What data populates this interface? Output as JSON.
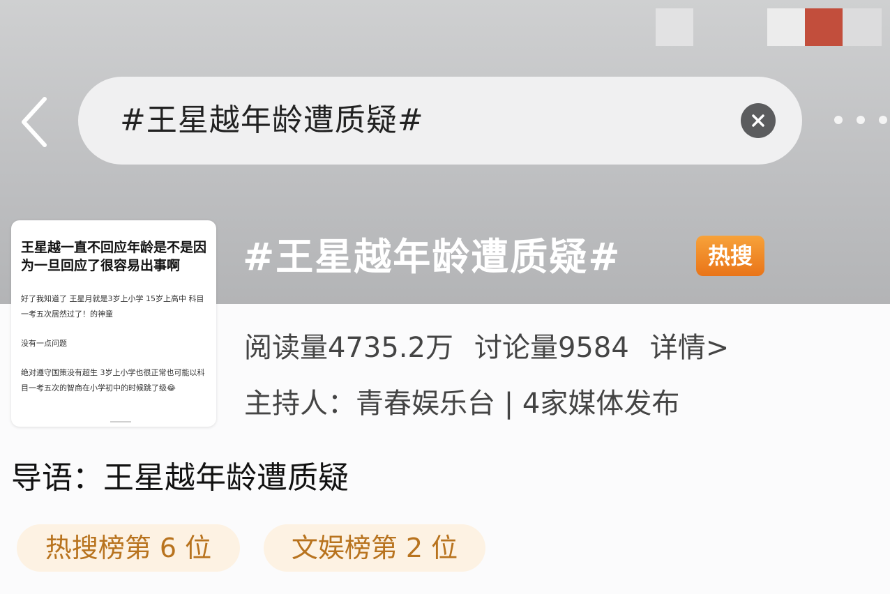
{
  "search": {
    "query": "#王星越年龄遭质疑#"
  },
  "topic": {
    "title": "#王星越年龄遭质疑#",
    "hot_badge": "热搜",
    "reads": "阅读量4735.2万",
    "discussions": "讨论量9584",
    "details_link": "详情>",
    "host_line": "主持人：青春娱乐台 | 4家媒体发布",
    "lead": "导语：王星越年龄遭质疑"
  },
  "thumbnail": {
    "title": "王星越一直不回应年龄是不是因为一旦回应了很容易出事啊",
    "body_1": "好了我知道了 王星月就是3岁上小学 15岁上高中 科目一考五次居然过了！的神童",
    "body_2": "没有一点问题",
    "body_3": "绝对遵守国策没有超生 3岁上小学也很正常也可能以科目一考五次的智商在小学初中的时候跳了级😂"
  },
  "tags": [
    {
      "label": "热搜榜第 6 位"
    },
    {
      "label": "文娱榜第 2 位"
    }
  ],
  "colors": {
    "hot_badge": "#ee8a22",
    "tag_bg": "#fdf2e3",
    "tag_text": "#b8731e",
    "header_bg": "#c3c4c6"
  }
}
